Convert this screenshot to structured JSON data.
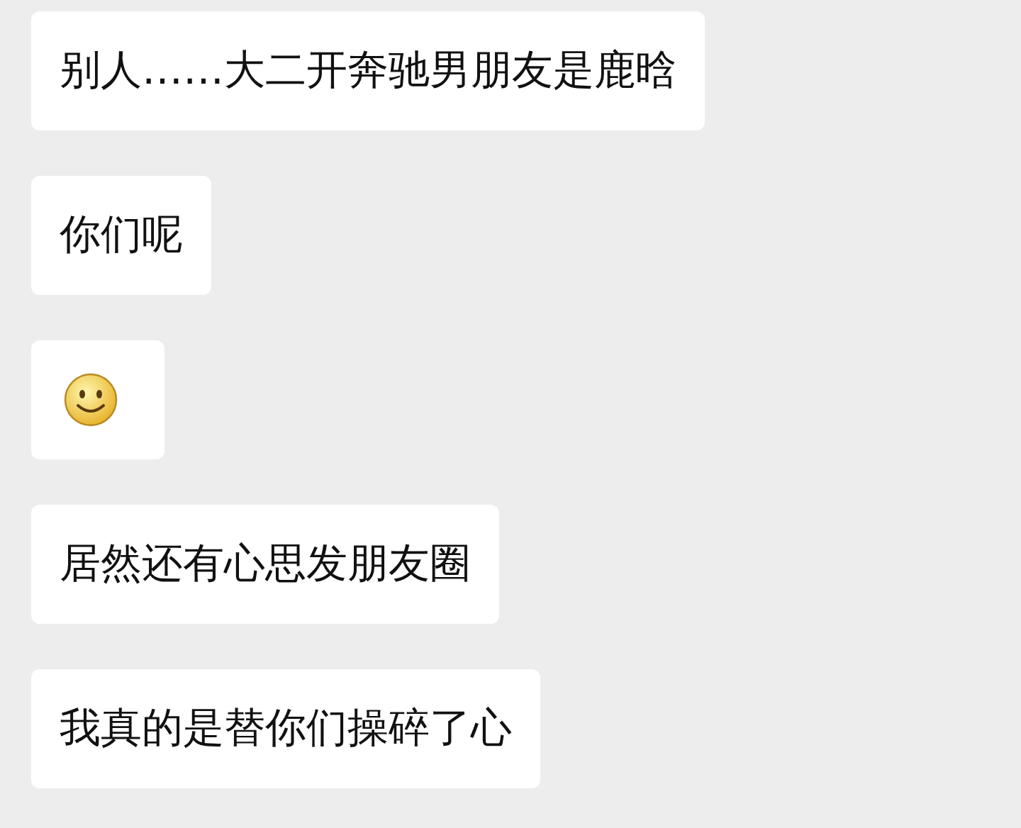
{
  "messages": [
    {
      "kind": "text",
      "text": "别人……大二开奔驰男朋友是鹿晗"
    },
    {
      "kind": "text",
      "text": "你们呢"
    },
    {
      "kind": "emoji"
    },
    {
      "kind": "text",
      "text": "居然还有心思发朋友圈"
    },
    {
      "kind": "text",
      "text": "我真的是替你们操碎了心"
    }
  ]
}
